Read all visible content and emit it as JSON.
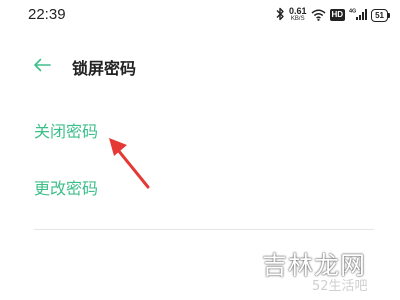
{
  "status_bar": {
    "time": "22:39",
    "net_speed_value": "0.61",
    "net_speed_unit": "KB/S",
    "hd_label": "HD",
    "battery_level": "51",
    "icons": [
      "bluetooth-icon",
      "wifi-icon",
      "hd-icon",
      "signal-4g-icon",
      "battery-icon"
    ]
  },
  "header": {
    "back_icon": "arrow-left-icon",
    "title": "锁屏密码"
  },
  "menu": {
    "items": [
      {
        "label": "关闭密码"
      },
      {
        "label": "更改密码"
      }
    ]
  },
  "annotation": {
    "icon": "red-arrow-icon"
  },
  "watermark": {
    "main": "吉林龙网",
    "sub": "52生活吧"
  },
  "colors": {
    "accent": "#3dbf8a",
    "text": "#222222",
    "arrow": "#e53935",
    "divider": "#e6e6e6"
  }
}
